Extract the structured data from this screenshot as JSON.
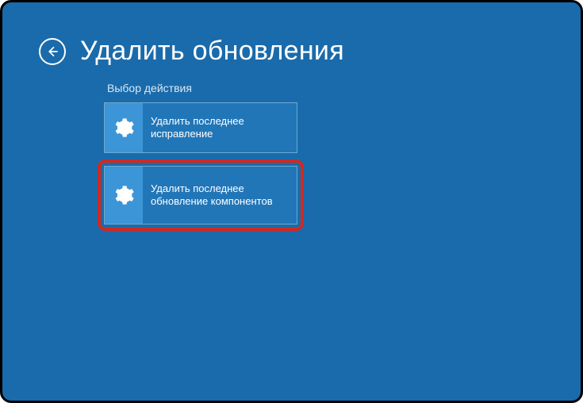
{
  "header": {
    "title": "Удалить обновления"
  },
  "subtitle": "Выбор действия",
  "options": {
    "quality": {
      "icon": "gear-icon",
      "label": "Удалить последнее исправление"
    },
    "feature": {
      "icon": "gear-icon",
      "label": "Удалить последнее обновление компонентов"
    }
  }
}
